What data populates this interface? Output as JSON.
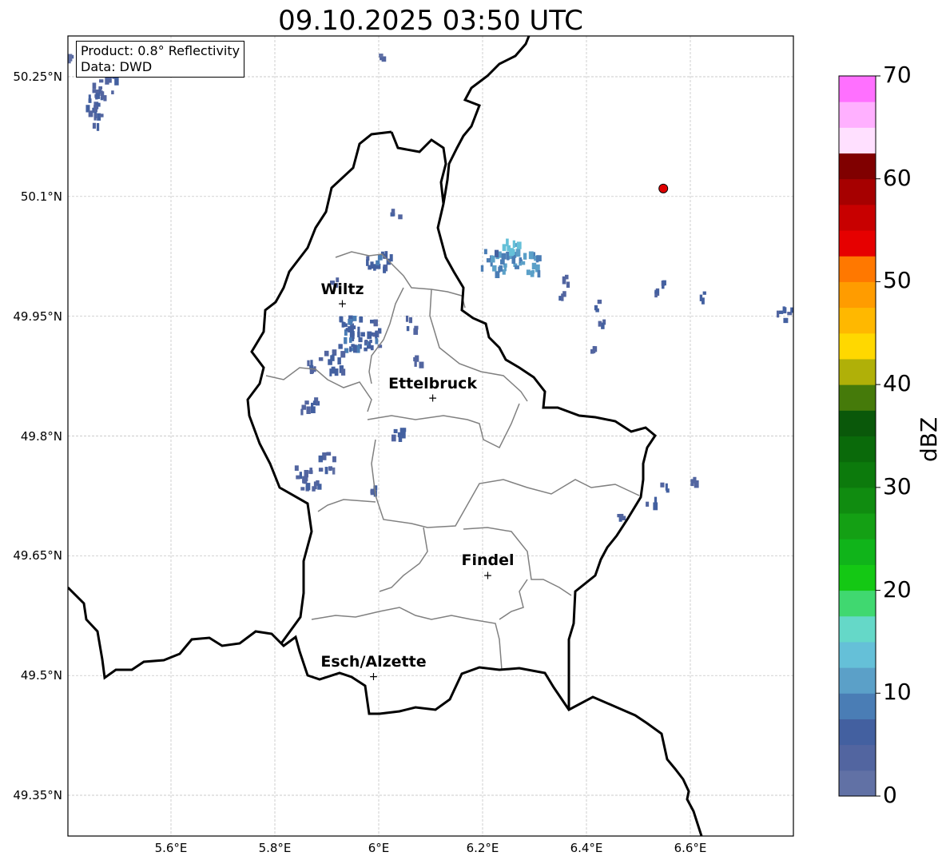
{
  "title": "09.10.2025 03:50 UTC",
  "info": {
    "product": "Product: 0.8° Reflectivity",
    "data": "Data: DWD"
  },
  "map": {
    "lon_min": 5.4,
    "lon_max": 6.8,
    "lat_min": 49.3,
    "lat_max": 50.3
  },
  "axes": {
    "lat_ticks": [
      {
        "value": 50.25,
        "label": "50.25°N"
      },
      {
        "value": 50.1,
        "label": "50.1°N"
      },
      {
        "value": 49.95,
        "label": "49.95°N"
      },
      {
        "value": 49.8,
        "label": "49.8°N"
      },
      {
        "value": 49.65,
        "label": "49.65°N"
      },
      {
        "value": 49.5,
        "label": "49.5°N"
      },
      {
        "value": 49.35,
        "label": "49.35°N"
      }
    ],
    "lon_ticks": [
      {
        "value": 5.6,
        "label": "5.6°E"
      },
      {
        "value": 5.8,
        "label": "5.8°E"
      },
      {
        "value": 6.0,
        "label": "6°E"
      },
      {
        "value": 6.2,
        "label": "6.2°E"
      },
      {
        "value": 6.4,
        "label": "6.4°E"
      },
      {
        "value": 6.6,
        "label": "6.6°E"
      }
    ]
  },
  "cities": [
    {
      "name": "Wiltz",
      "lon": 5.93,
      "lat": 49.966
    },
    {
      "name": "Ettelbruck",
      "lon": 6.104,
      "lat": 49.848
    },
    {
      "name": "Findel",
      "lon": 6.21,
      "lat": 49.626
    },
    {
      "name": "Esch/Alzette",
      "lon": 5.99,
      "lat": 49.499
    }
  ],
  "radar_site": {
    "lon": 6.548,
    "lat": 50.11,
    "color": "#e00000"
  },
  "colorbar": {
    "unit": "dBZ",
    "min": 0,
    "max": 70,
    "step": 2.5,
    "tick_labels": [
      "0",
      "10",
      "20",
      "30",
      "40",
      "50",
      "60",
      "70"
    ],
    "tick_values": [
      0,
      10,
      20,
      30,
      40,
      50,
      60,
      70
    ],
    "colors": [
      "#6171a5",
      "#5265a0",
      "#4360a0",
      "#4a7db5",
      "#5ba0c8",
      "#65c0d8",
      "#65d8c8",
      "#40d870",
      "#14c814",
      "#10b41a",
      "#14a014",
      "#108c10",
      "#0c7a0c",
      "#0a6a0a",
      "#0a580a",
      "#457a0a",
      "#b0b008",
      "#ffd800",
      "#ffb800",
      "#ff9c00",
      "#ff7800",
      "#e60000",
      "#c80000",
      "#a60000",
      "#800000",
      "#ffe0ff",
      "#ffb0ff",
      "#ff70ff",
      "#ee38ee"
    ]
  },
  "echoes": [
    {
      "lon": 5.45,
      "lat": 50.215,
      "dbz": 4,
      "w": 10,
      "h": 25
    },
    {
      "lon": 5.47,
      "lat": 50.25,
      "dbz": 4,
      "w": 14,
      "h": 25
    },
    {
      "lon": 5.5,
      "lat": 50.27,
      "dbz": 5,
      "w": 8,
      "h": 15
    },
    {
      "lon": 5.405,
      "lat": 50.285,
      "dbz": 3,
      "w": 4,
      "h": 10
    },
    {
      "lon": 6.003,
      "lat": 50.28,
      "dbz": 3,
      "w": 4,
      "h": 12
    },
    {
      "lon": 6.03,
      "lat": 50.08,
      "dbz": 5,
      "w": 9,
      "h": 6
    },
    {
      "lon": 6.0,
      "lat": 50.02,
      "dbz": 6,
      "w": 18,
      "h": 12
    },
    {
      "lon": 5.91,
      "lat": 49.99,
      "dbz": 4,
      "w": 6,
      "h": 10
    },
    {
      "lon": 5.97,
      "lat": 49.93,
      "dbz": 6,
      "w": 20,
      "h": 22
    },
    {
      "lon": 5.94,
      "lat": 49.93,
      "dbz": 7,
      "w": 14,
      "h": 20
    },
    {
      "lon": 5.91,
      "lat": 49.9,
      "dbz": 5,
      "w": 12,
      "h": 16
    },
    {
      "lon": 5.87,
      "lat": 49.89,
      "dbz": 4,
      "w": 10,
      "h": 10
    },
    {
      "lon": 6.06,
      "lat": 49.94,
      "dbz": 4,
      "w": 6,
      "h": 12
    },
    {
      "lon": 6.07,
      "lat": 49.9,
      "dbz": 4,
      "w": 6,
      "h": 10
    },
    {
      "lon": 5.86,
      "lat": 49.84,
      "dbz": 4,
      "w": 12,
      "h": 10
    },
    {
      "lon": 6.04,
      "lat": 49.805,
      "dbz": 5,
      "w": 12,
      "h": 8
    },
    {
      "lon": 5.86,
      "lat": 49.75,
      "dbz": 4,
      "w": 16,
      "h": 14
    },
    {
      "lon": 5.9,
      "lat": 49.77,
      "dbz": 4,
      "w": 12,
      "h": 10
    },
    {
      "lon": 5.99,
      "lat": 49.74,
      "dbz": 5,
      "w": 5,
      "h": 12
    },
    {
      "lon": 6.23,
      "lat": 50.02,
      "dbz": 9,
      "w": 22,
      "h": 16
    },
    {
      "lon": 6.25,
      "lat": 50.04,
      "dbz": 12,
      "w": 12,
      "h": 10
    },
    {
      "lon": 6.29,
      "lat": 50.02,
      "dbz": 10,
      "w": 14,
      "h": 18
    },
    {
      "lon": 6.36,
      "lat": 49.997,
      "dbz": 4,
      "w": 8,
      "h": 5
    },
    {
      "lon": 6.35,
      "lat": 49.978,
      "dbz": 4,
      "w": 5,
      "h": 4
    },
    {
      "lon": 6.42,
      "lat": 49.965,
      "dbz": 4,
      "w": 4,
      "h": 6
    },
    {
      "lon": 6.42,
      "lat": 49.945,
      "dbz": 4,
      "w": 8,
      "h": 5
    },
    {
      "lon": 6.41,
      "lat": 49.91,
      "dbz": 4,
      "w": 5,
      "h": 4
    },
    {
      "lon": 6.53,
      "lat": 49.985,
      "dbz": 4,
      "w": 3,
      "h": 4
    },
    {
      "lon": 6.545,
      "lat": 49.994,
      "dbz": 4,
      "w": 3,
      "h": 3
    },
    {
      "lon": 6.62,
      "lat": 49.978,
      "dbz": 4,
      "w": 3,
      "h": 6
    },
    {
      "lon": 6.78,
      "lat": 49.955,
      "dbz": 5,
      "w": 12,
      "h": 8
    },
    {
      "lon": 6.535,
      "lat": 49.738,
      "dbz": 5,
      "w": 12,
      "h": 4
    },
    {
      "lon": 6.6,
      "lat": 49.75,
      "dbz": 4,
      "w": 8,
      "h": 6
    },
    {
      "lon": 6.525,
      "lat": 49.72,
      "dbz": 5,
      "w": 8,
      "h": 6
    },
    {
      "lon": 6.46,
      "lat": 49.703,
      "dbz": 4,
      "w": 10,
      "h": 6
    }
  ]
}
